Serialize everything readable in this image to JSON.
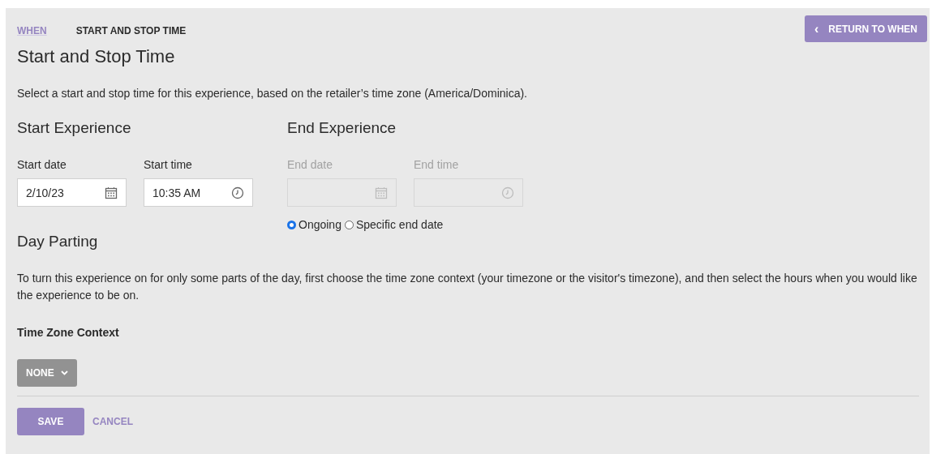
{
  "breadcrumb": [
    {
      "label": "WHEN",
      "kind": "link"
    },
    {
      "label": "START AND STOP TIME",
      "kind": "current"
    }
  ],
  "return_button": {
    "icon": "‹",
    "label": "RETURN TO WHEN"
  },
  "title": "Start and Stop Time",
  "description": "Select a start and stop time for this experience, based on the retailer’s time zone (America/Dominica).",
  "sections": [
    {
      "heading": "Start Experience",
      "fields": [
        {
          "label": "Start date",
          "value": "2/10/23",
          "kind": "date",
          "disabled": false
        },
        {
          "label": "Start time",
          "value": "10:35 AM",
          "kind": "time",
          "disabled": false
        }
      ]
    },
    {
      "heading": "End Experience",
      "fields": [
        {
          "label": "End date",
          "kind": "date",
          "disabled": true
        },
        {
          "label": "End time",
          "kind": "time",
          "disabled": true
        }
      ],
      "options": [
        {
          "label": "Ongoing",
          "selected": true
        },
        {
          "label": "Specific end date",
          "selected": false
        }
      ]
    }
  ],
  "day_parting": {
    "heading": "Day Parting",
    "description": "To turn this experience on for only some parts of the day, first choose the time zone context (your timezone or the visitor's timezone), and then select the hours when you would like the experience to be on.",
    "context_label": "Time Zone Context",
    "dropdown": "NONE"
  },
  "actions": {
    "save": "SAVE",
    "cancel": "CANCEL"
  }
}
